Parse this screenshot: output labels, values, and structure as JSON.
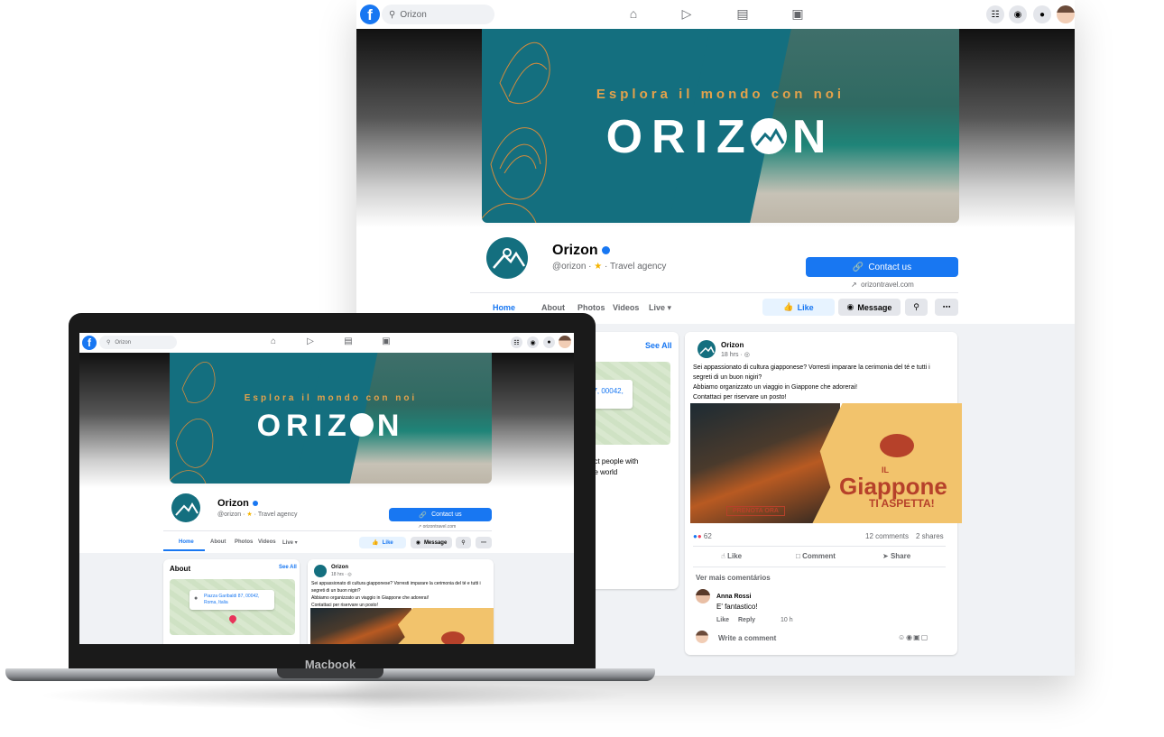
{
  "brand": {
    "tagline": "Esplora il mondo con noi",
    "logo_text": "ORIZ",
    "logo_end": "N"
  },
  "topbar": {
    "search_text": "Orizon",
    "nav_icons": [
      "home-icon",
      "video-icon",
      "marketplace-icon",
      "groups-icon"
    ],
    "right_icons": [
      "menu-grid-icon",
      "messenger-icon",
      "notifications-icon"
    ]
  },
  "page": {
    "name": "Orizon",
    "handle": "@orizon",
    "separator": "·",
    "category": "Travel agency",
    "contact_label": "Contact us",
    "website": "orizontravel.com",
    "tabs": [
      "Home",
      "About",
      "Photos",
      "Videos",
      "Live"
    ],
    "like_label": "Like",
    "message_label": "Message"
  },
  "about": {
    "title": "About",
    "see_all": "See All",
    "address_l1": "Piazza Garibaldi 87, 00042,",
    "address_l2": "Roma, Italia",
    "address_partial": "87, 00042,",
    "mission_partial_1": "ect  people with",
    "mission_partial_2": "he world"
  },
  "post": {
    "author": "Orizon",
    "time": "18 hrs · ",
    "text_l1": "Sei appassionato di cultura giapponese? Vorresti imparare la cerimonia del té e tutti i",
    "text_l2": "segreti di un buon nigiri?",
    "text_l3": "Abbiamo organizzato un viaggio in Giappone che adorerai!",
    "text_l4": "Contattaci per riservare un posto!",
    "image_small": "IL",
    "image_title": "Giappone",
    "image_subtitle": "TI ASPETTA!",
    "image_cta": "PRENOTA ORA",
    "reactions_count": "62",
    "comments_count": "12 comments",
    "shares_count": "2 shares",
    "like_action": "Like",
    "comment_action": "Comment",
    "share_action": "Share",
    "more_comments": "Ver mais comentários",
    "comment_author": "Anna Rossi",
    "comment_text": "E' fantastico!",
    "comment_like": "Like",
    "comment_reply": "Reply",
    "comment_time": "10 h",
    "write_placeholder": "Write a comment"
  },
  "laptop": {
    "label": "Macbook"
  },
  "colors": {
    "facebook_blue": "#1877f2",
    "brand_teal": "#146f7f",
    "brand_orange": "#e4a24b",
    "page_background": "#f0f2f5"
  }
}
